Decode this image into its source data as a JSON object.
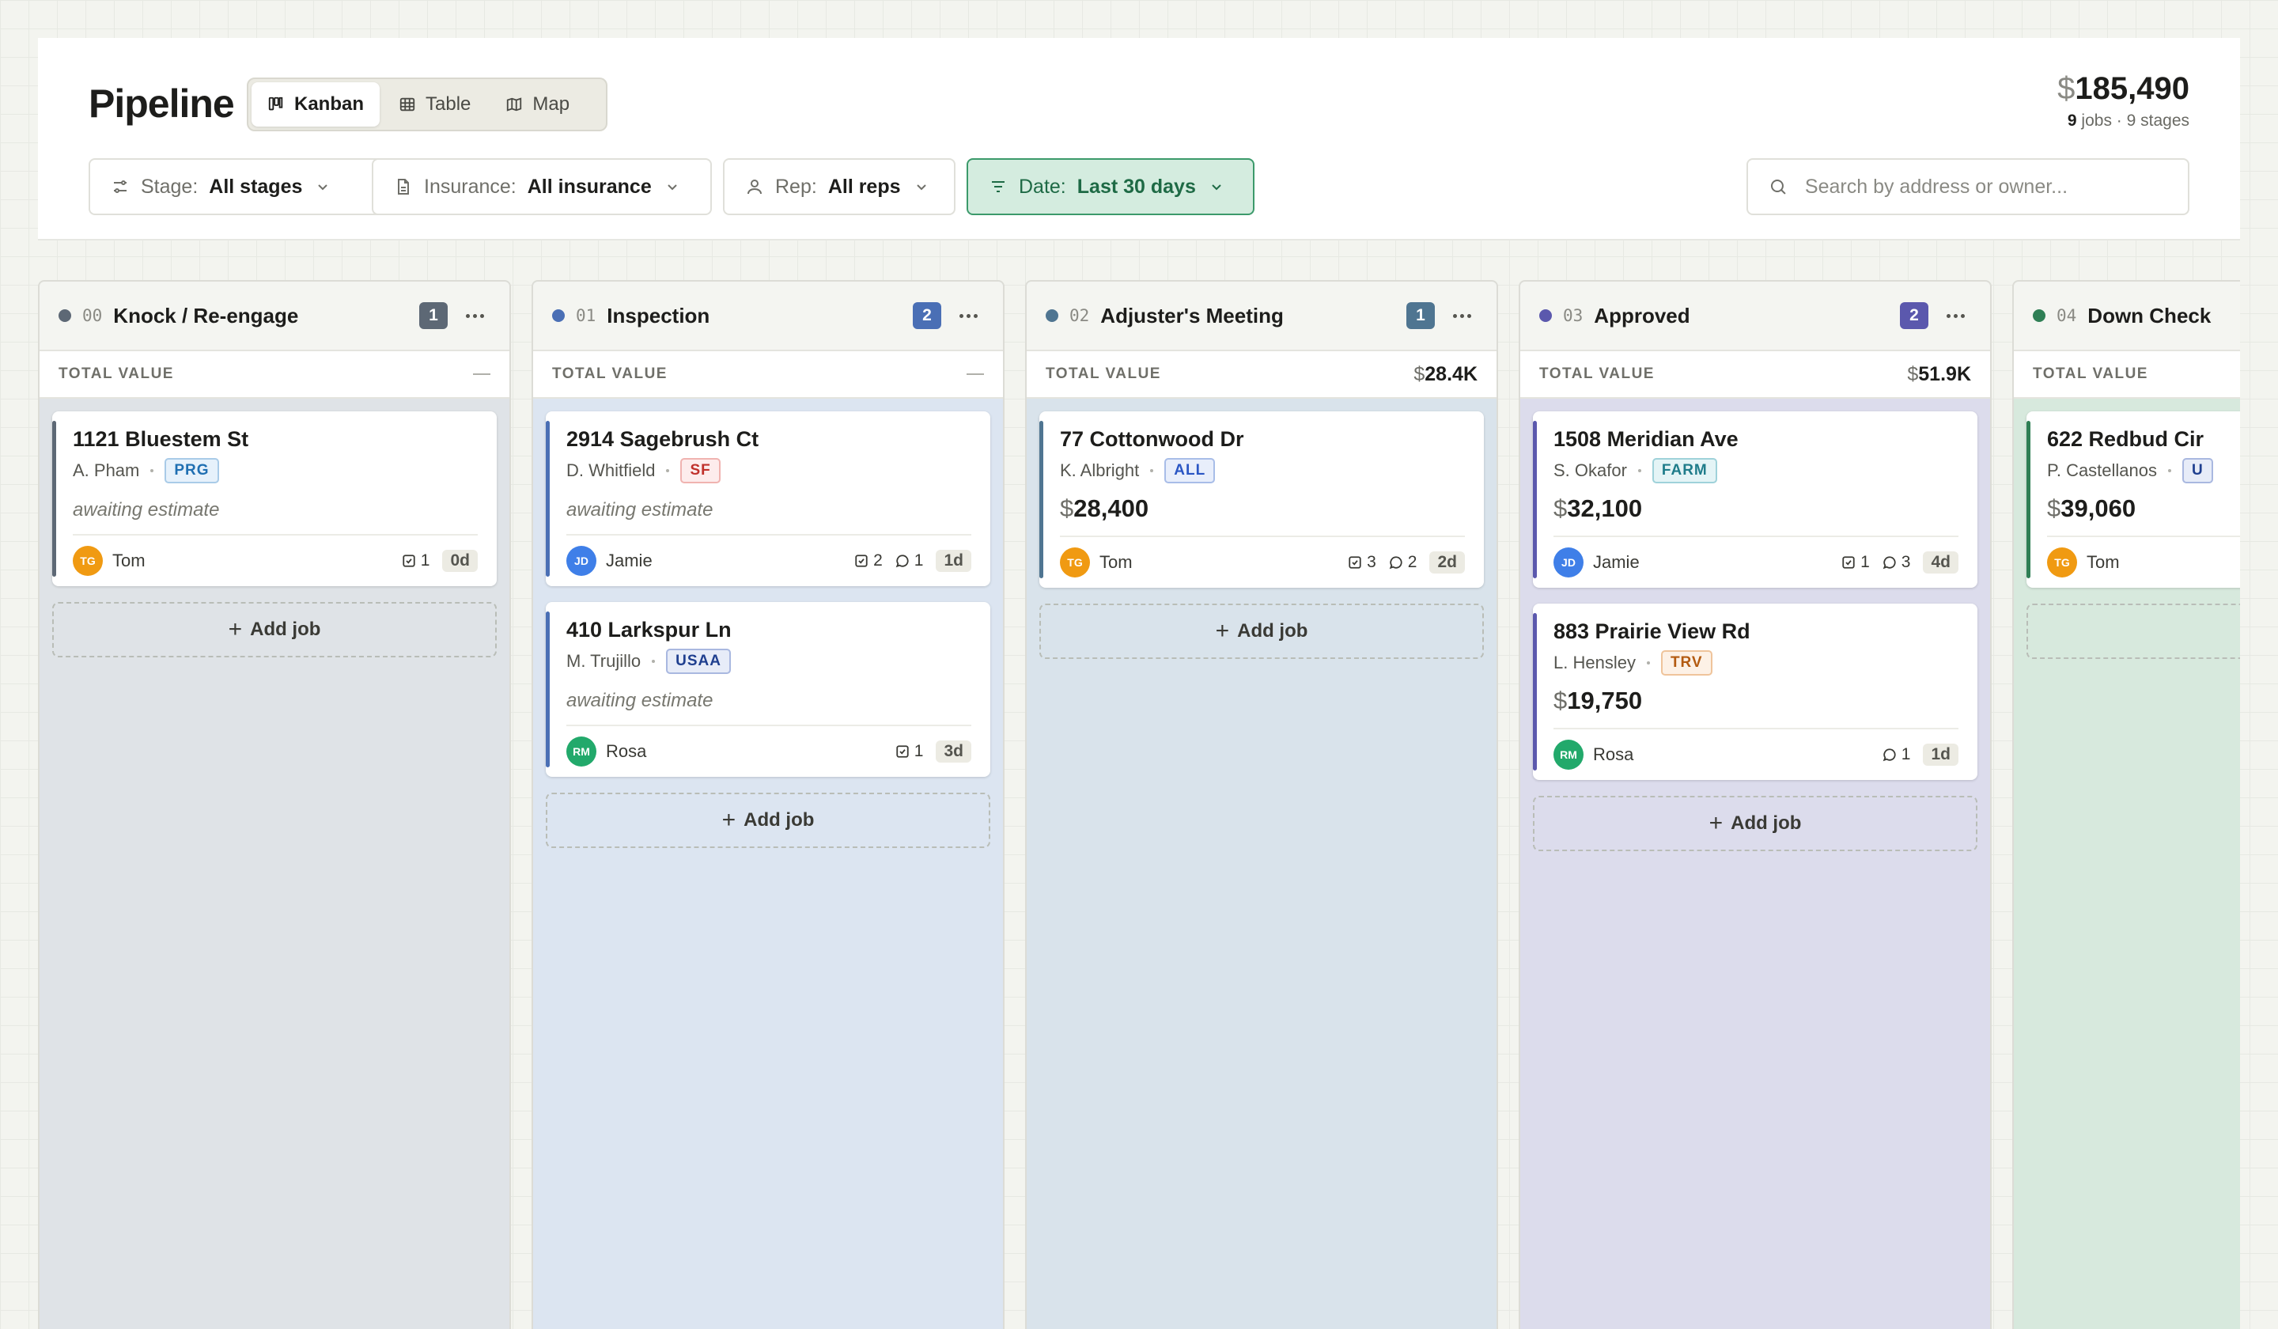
{
  "header": {
    "title": "Pipeline",
    "views": [
      {
        "label": "Kanban",
        "icon": "kanban-icon",
        "active": true
      },
      {
        "label": "Table",
        "icon": "table-icon",
        "active": false
      },
      {
        "label": "Map",
        "icon": "map-icon",
        "active": false
      }
    ],
    "total_currency": "$",
    "total_value": "185,490",
    "jobs_count": "9",
    "jobs_suffix": " jobs · 9 stages"
  },
  "filters": {
    "stage": {
      "label": "Stage:",
      "value": "All stages",
      "icon": "sliders-icon"
    },
    "insurance": {
      "label": "Insurance:",
      "value": "All insurance",
      "icon": "document-icon"
    },
    "rep": {
      "label": "Rep:",
      "value": "All reps",
      "icon": "person-icon"
    },
    "date": {
      "label": "Date:",
      "value": "Last 30 days",
      "icon": "filter-icon",
      "active": true
    },
    "search_placeholder": "Search by address or owner..."
  },
  "total_label": "TOTAL VALUE",
  "add_job_label": "Add job",
  "columns": [
    {
      "num": "00",
      "name": "Knock / Re-engage",
      "count": "1",
      "color": "#5d6875",
      "total_currency": "",
      "total": "",
      "cards": [
        {
          "address": "1121 Bluestem St",
          "owner": "A. Pham",
          "insurance": "PRG",
          "note": "awaiting estimate",
          "amount_currency": "",
          "amount": "",
          "rep_initials": "TG",
          "rep": "Tom",
          "tasks": "1",
          "comments": "",
          "age": "0d"
        }
      ]
    },
    {
      "num": "01",
      "name": "Inspection",
      "count": "2",
      "color": "#4a6fb5",
      "total_currency": "",
      "total": "",
      "cards": [
        {
          "address": "2914 Sagebrush Ct",
          "owner": "D. Whitfield",
          "insurance": "SF",
          "note": "awaiting estimate",
          "amount_currency": "",
          "amount": "",
          "rep_initials": "JD",
          "rep": "Jamie",
          "tasks": "2",
          "comments": "1",
          "age": "1d"
        },
        {
          "address": "410 Larkspur Ln",
          "owner": "M. Trujillo",
          "insurance": "USAA",
          "note": "awaiting estimate",
          "amount_currency": "",
          "amount": "",
          "rep_initials": "RM",
          "rep": "Rosa",
          "tasks": "1",
          "comments": "",
          "age": "3d"
        }
      ]
    },
    {
      "num": "02",
      "name": "Adjuster's Meeting",
      "count": "1",
      "color": "#4f7591",
      "total_currency": "$",
      "total": "28.4K",
      "cards": [
        {
          "address": "77 Cottonwood Dr",
          "owner": "K. Albright",
          "insurance": "ALL",
          "note": "",
          "amount_currency": "$",
          "amount": "28,400",
          "rep_initials": "TG",
          "rep": "Tom",
          "tasks": "3",
          "comments": "2",
          "age": "2d"
        }
      ]
    },
    {
      "num": "03",
      "name": "Approved",
      "count": "2",
      "color": "#5b58ad",
      "total_currency": "$",
      "total": "51.9K",
      "cards": [
        {
          "address": "1508 Meridian Ave",
          "owner": "S. Okafor",
          "insurance": "FARM",
          "note": "",
          "amount_currency": "$",
          "amount": "32,100",
          "rep_initials": "JD",
          "rep": "Jamie",
          "tasks": "1",
          "comments": "3",
          "age": "4d"
        },
        {
          "address": "883 Prairie View Rd",
          "owner": "L. Hensley",
          "insurance": "TRV",
          "note": "",
          "amount_currency": "$",
          "amount": "19,750",
          "rep_initials": "RM",
          "rep": "Rosa",
          "tasks": "",
          "comments": "1",
          "age": "1d"
        }
      ]
    },
    {
      "num": "04",
      "name": "Down Check",
      "count": "",
      "color": "#2f7f55",
      "total_currency": "",
      "total": "",
      "cards": [
        {
          "address": "622 Redbud Cir",
          "owner": "P. Castellanos",
          "insurance": "U",
          "note": "",
          "amount_currency": "$",
          "amount": "39,060",
          "rep_initials": "TG",
          "rep": "Tom",
          "tasks": "",
          "comments": "",
          "age": ""
        }
      ]
    }
  ],
  "styles": {
    "column_bg": [
      "#dfe3e7",
      "#dce5f1",
      "#d9e3eb",
      "#dcdcec",
      "#d7e9dd"
    ],
    "avatar_colors": {
      "TG": "#f09a12",
      "JD": "#3f7fe8",
      "RM": "#22a96b"
    },
    "insurance_colors": {
      "PRG": {
        "fg": "#1f6fb2",
        "bg": "#e6f1fb",
        "border": "#a9cbe8"
      },
      "SF": {
        "fg": "#c0312b",
        "bg": "#fdecec",
        "border": "#f0b3b0"
      },
      "USAA": {
        "fg": "#1f3f8f",
        "bg": "#e7ecf8",
        "border": "#a9b8e0"
      },
      "ALL": {
        "fg": "#2a56c4",
        "bg": "#e8eefb",
        "border": "#a8bde8"
      },
      "FARM": {
        "fg": "#1f7c8a",
        "bg": "#e4f4f6",
        "border": "#9fd2da"
      },
      "TRV": {
        "fg": "#b35a10",
        "bg": "#fdf1e6",
        "border": "#efc49b"
      },
      "U": {
        "fg": "#1f3f8f",
        "bg": "#e7ecf8",
        "border": "#a9b8e0"
      }
    }
  }
}
